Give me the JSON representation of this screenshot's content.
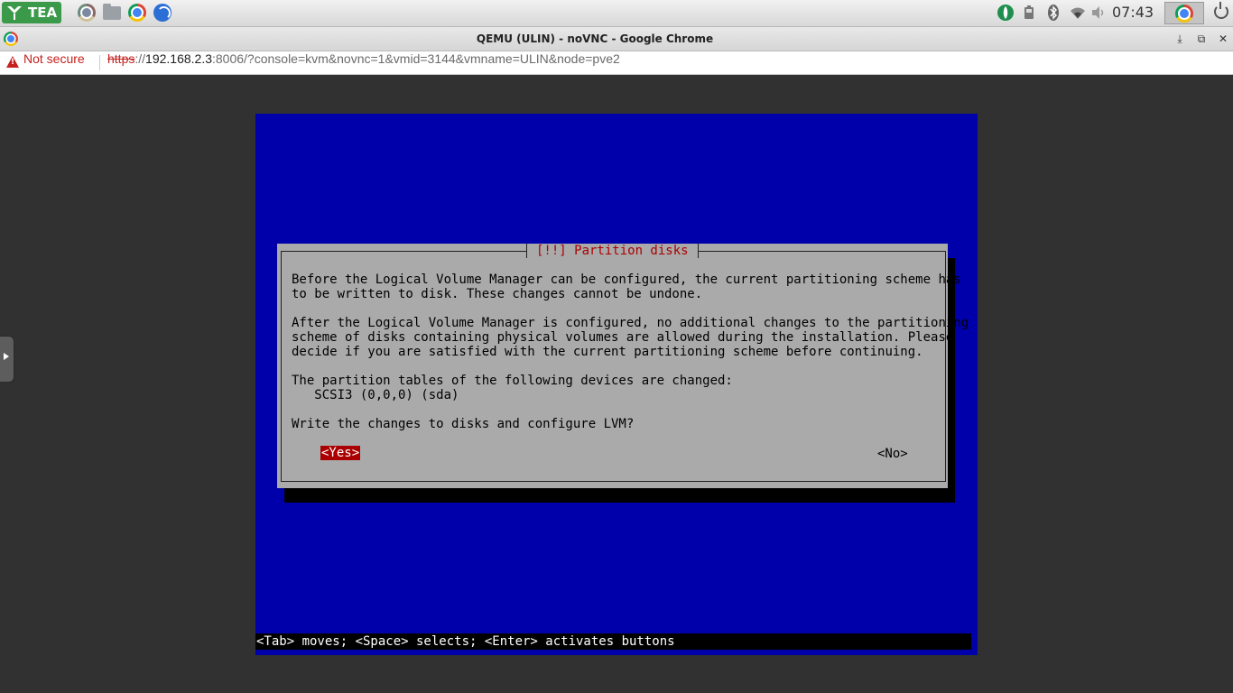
{
  "taskbar": {
    "launcher_label": "TEA",
    "launcher_icon": "leaf-icon",
    "pinned_apps": [
      "chromium-icon",
      "file-manager-icon",
      "chrome-icon",
      "browser-globe-icon"
    ],
    "tray_icons": [
      "shield-icon",
      "battery-icon",
      "bluetooth-icon",
      "wifi-icon",
      "volume-icon"
    ],
    "clock": "07:43"
  },
  "window": {
    "title": "QEMU (ULIN) - noVNC - Google Chrome"
  },
  "addressbar": {
    "security_label": "Not secure",
    "url_scheme": "https",
    "url_sep": "://",
    "url_host": "192.168.2.3",
    "url_rest": ":8006/?console=kvm&novnc=1&vmid=3144&vmname=ULIN&node=pve2"
  },
  "installer": {
    "dialog_title": "[!!] Partition disks",
    "paragraph1": "Before the Logical Volume Manager can be configured, the current partitioning scheme has\nto be written to disk. These changes cannot be undone.",
    "paragraph2": "After the Logical Volume Manager is configured, no additional changes to the partitioning\nscheme of disks containing physical volumes are allowed during the installation. Please\ndecide if you are satisfied with the current partitioning scheme before continuing.",
    "paragraph3": "The partition tables of the following devices are changed:\n   SCSI3 (0,0,0) (sda)",
    "question": "Write the changes to disks and configure LVM?",
    "yes_label": "<Yes>",
    "no_label": "<No>",
    "status_line": "<Tab> moves; <Space> selects; <Enter> activates buttons"
  },
  "colors": {
    "console_background": "#0000aa",
    "dialog_background": "#aaaaaa",
    "accent_red": "#aa0000"
  }
}
